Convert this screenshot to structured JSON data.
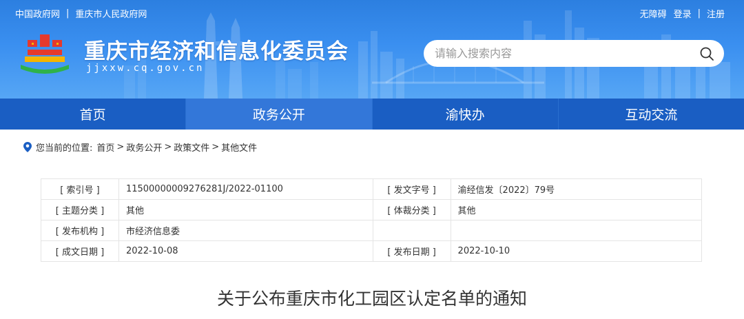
{
  "top_links": {
    "gov_cn": "中国政府网",
    "cq_gov": "重庆市人民政府网",
    "divider": "|",
    "accessibility": "无障碍",
    "login": "登录",
    "register": "注册"
  },
  "site": {
    "title": "重庆市经济和信息化委员会",
    "domain": "jjxxw.cq.gov.cn"
  },
  "search": {
    "placeholder": "请输入搜索内容"
  },
  "nav": {
    "items": [
      {
        "label": "首页"
      },
      {
        "label": "政务公开",
        "active": true
      },
      {
        "label": "渝快办"
      },
      {
        "label": "互动交流"
      }
    ]
  },
  "breadcrumb": {
    "prefix": "您当前的位置:",
    "items": [
      "首页",
      "政务公开",
      "政策文件",
      "其他文件"
    ],
    "separator": ">"
  },
  "info_table": {
    "rows": [
      {
        "l1": "[ 索引号 ]",
        "v1": "11500000009276281J/2022-01100",
        "l2": "[ 发文字号 ]",
        "v2": "渝经信发〔2022〕79号"
      },
      {
        "l1": "[ 主题分类 ]",
        "v1": "其他",
        "l2": "[ 体裁分类 ]",
        "v2": "其他"
      },
      {
        "l1": "[ 发布机构 ]",
        "v1": "市经济信息委",
        "l2": "",
        "v2": ""
      },
      {
        "l1": "[ 成文日期 ]",
        "v1": "2022-10-08",
        "l2": "[ 发布日期 ]",
        "v2": "2022-10-10"
      }
    ]
  },
  "document": {
    "title": "关于公布重庆市化工园区认定名单的通知"
  },
  "colors": {
    "header_blue": "#3a8ff0",
    "nav_blue": "#1a5ec3",
    "nav_active": "#3377d9",
    "logo_red": "#e5392c",
    "logo_yellow": "#f5b400",
    "logo_green": "#2fb24a"
  }
}
